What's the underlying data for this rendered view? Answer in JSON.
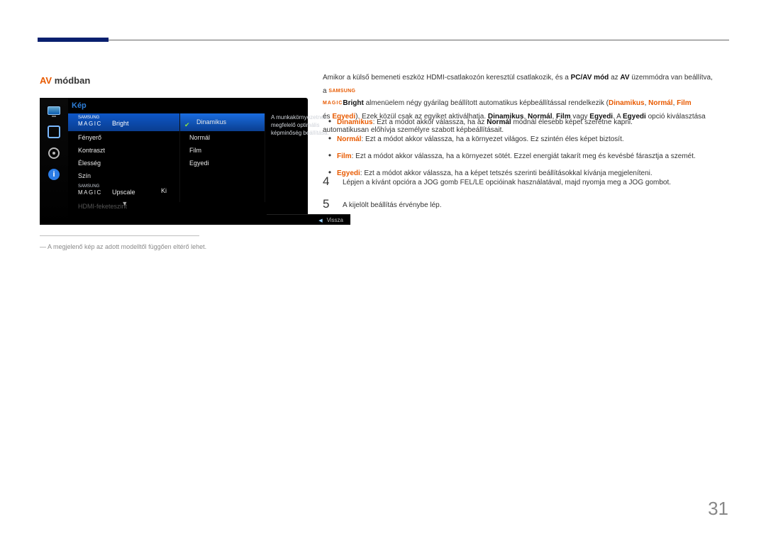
{
  "page_number": "31",
  "title_av": "AV",
  "title_rest": " módban",
  "osd": {
    "header": "Kép",
    "samsung": "SAMSUNG",
    "magic": "MAGIC",
    "bright": "Bright",
    "upscale": "Upscale",
    "menu1": [
      "Fényerő",
      "Kontraszt",
      "Élesség",
      "Szín"
    ],
    "upscale_val": "Ki",
    "hdmi_black": "HDMI-feketeszint",
    "options": [
      "Dinamikus",
      "Normál",
      "Film",
      "Egyedi"
    ],
    "desc": "A munkakörnyezetnek megfelelő optimális képminőség beállítása.",
    "back": "Vissza"
  },
  "footnote": "― A megjelenő kép az adott modelltől függően eltérő lehet.",
  "intro": {
    "line1_pre": "Amikor a külső bemeneti eszköz HDMI-csatlakozón keresztül csatlakozik, és a ",
    "pcav": "PC/AV mód",
    "line1_mid": " az ",
    "av": "AV",
    "line1_post": " üzemmódra van beállítva,",
    "line2_pre": "a ",
    "bright": "Bright",
    "line2_post": " almenüelem négy gyárilag beállított automatikus képbeállítással rendelkezik (",
    "opts1": "Dinamikus",
    "c1": ", ",
    "opts2": "Normál",
    "c2": ", ",
    "opts3": "Film",
    "line3_pre": "és ",
    "opts4": "Egyedi",
    "line3_mid": "). Ezek közül csak az egyiket aktiválhatja. ",
    "d": "Dinamikus",
    "c3": ", ",
    "n": "Normál",
    "c4": ", ",
    "f": "Film",
    "or": " vagy ",
    "e": "Egyedi",
    "line3_post": ". A ",
    "e2": "Egyedi",
    "line3_end": " opció kiválasztása",
    "line4": "automatikusan előhívja személyre szabott képbeállításait."
  },
  "bullets": [
    {
      "lead": "Dinamikus",
      "mid": ": Ezt a módot akkor válassza, ha az ",
      "inner": "Normál",
      "tail": " módnál élesebb képet szeretne kapni."
    },
    {
      "lead": "Normál",
      "mid": ": Ezt a módot akkor válassza, ha a környezet világos. Ez szintén éles képet biztosít.",
      "inner": "",
      "tail": ""
    },
    {
      "lead": "Film",
      "mid": ": Ezt a módot akkor válassza, ha a környezet sötét. Ezzel energiát takarít meg és kevésbé fárasztja a szemét.",
      "inner": "",
      "tail": ""
    },
    {
      "lead": "Egyedi",
      "mid": ": Ezt a módot akkor válassza, ha a képet tetszés szerinti beállításokkal kívánja megjeleníteni.",
      "inner": "",
      "tail": ""
    }
  ],
  "steps": {
    "s4num": "4",
    "s4txt": "Lépjen a kívánt opcióra a JOG gomb FEL/LE opcióinak használatával, majd nyomja meg a JOG gombot.",
    "s5num": "5",
    "s5txt": "A kijelölt beállítás érvénybe lép."
  }
}
